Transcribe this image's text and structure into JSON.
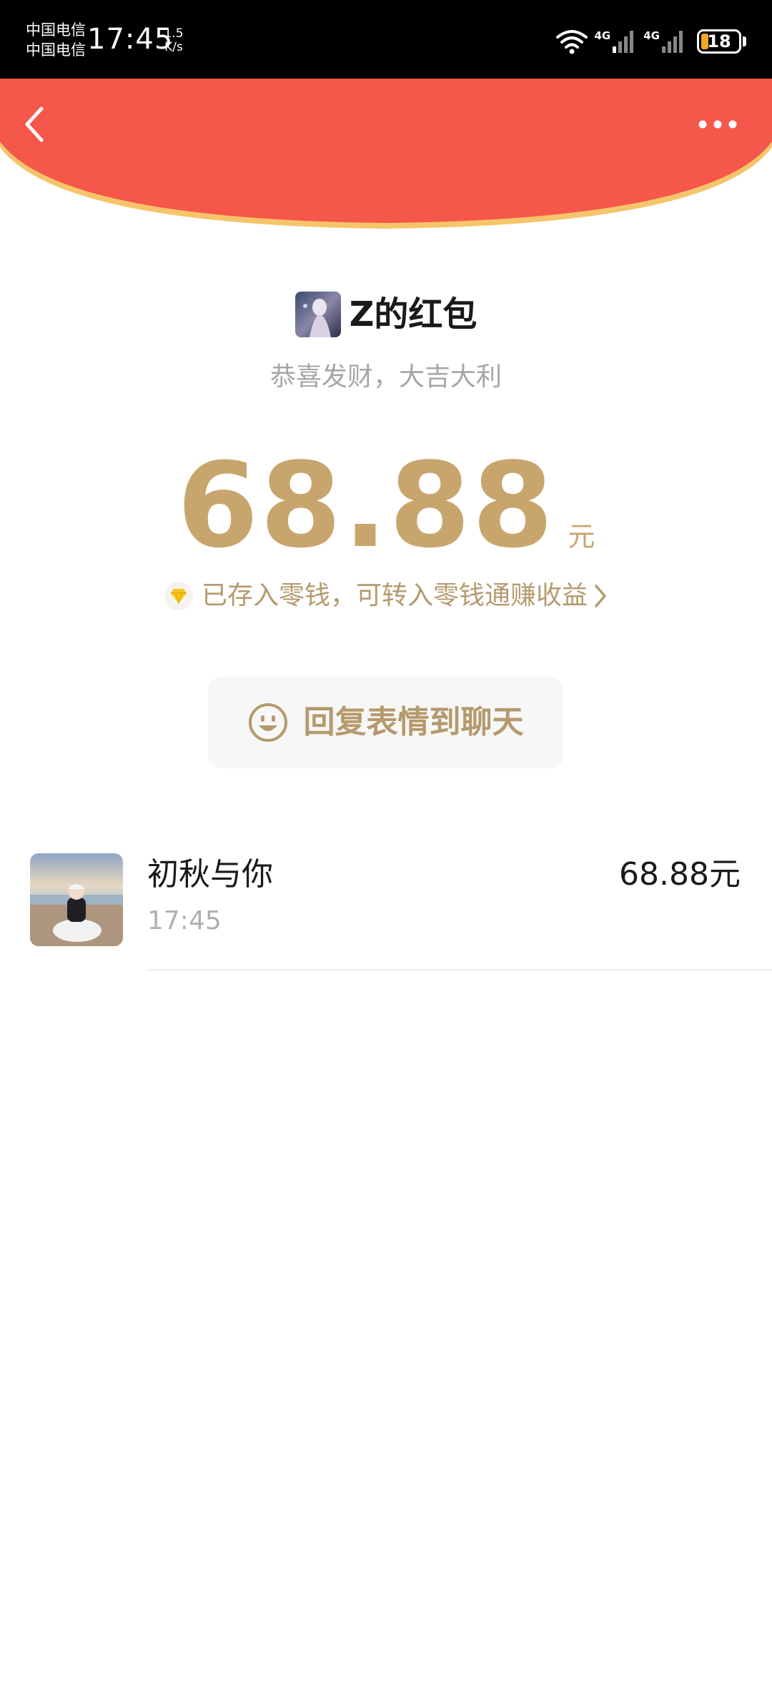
{
  "status_bar": {
    "carrier_1": "中国电信",
    "carrier_2": "中国电信",
    "time": "17:45",
    "net_speed_value": "1.5",
    "net_speed_unit": "K/s",
    "sim1_network": "4G",
    "sim2_network": "4G",
    "battery_level": "18",
    "battery_color": "#f5a623"
  },
  "header": {
    "back_icon": "chevron-left-icon",
    "more_icon": "more-dots-icon",
    "background_color": "#f5574a",
    "curve_edge_color": "#f6c56a"
  },
  "red_packet": {
    "sender_title": "Z的红包",
    "blessing": "恭喜发财，大吉大利",
    "amount": "68.88",
    "amount_unit": "元",
    "amount_color": "#c9a56e",
    "saved_notice": "已存入零钱，可转入零钱通赚收益",
    "saved_icon": "diamond-icon"
  },
  "reply_button": {
    "icon": "smiley-icon",
    "label": "回复表情到聊天"
  },
  "receivers": [
    {
      "name": "初秋与你",
      "time": "17:45",
      "amount": "68.88元"
    }
  ]
}
